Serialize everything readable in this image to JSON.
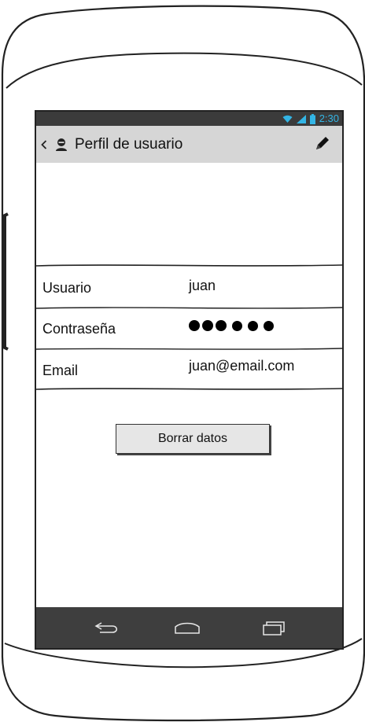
{
  "status_bar": {
    "time": "2:30",
    "wifi_icon": "wifi-icon",
    "signal_icon": "signal-icon",
    "battery_icon": "battery-icon",
    "color": "#33b5e5"
  },
  "action_bar": {
    "back_icon": "chevron-left-icon",
    "user_icon": "user-icon",
    "title": "Perfil de usuario",
    "edit_icon": "pencil-icon"
  },
  "profile": {
    "rows": [
      {
        "label": "Usuario",
        "value": "juan"
      },
      {
        "label": "Contraseña",
        "value": "●●●●●●"
      },
      {
        "label": "Email",
        "value": "juan@email.com"
      }
    ]
  },
  "actions": {
    "clear_label": "Borrar datos"
  },
  "nav_bar": {
    "back": "back-icon",
    "home": "home-icon",
    "recents": "recent-apps-icon"
  },
  "colors": {
    "status_bar_bg": "#3b3b3b",
    "action_bar_bg": "#d6d6d6",
    "nav_bar_bg": "#3e3e3e"
  }
}
